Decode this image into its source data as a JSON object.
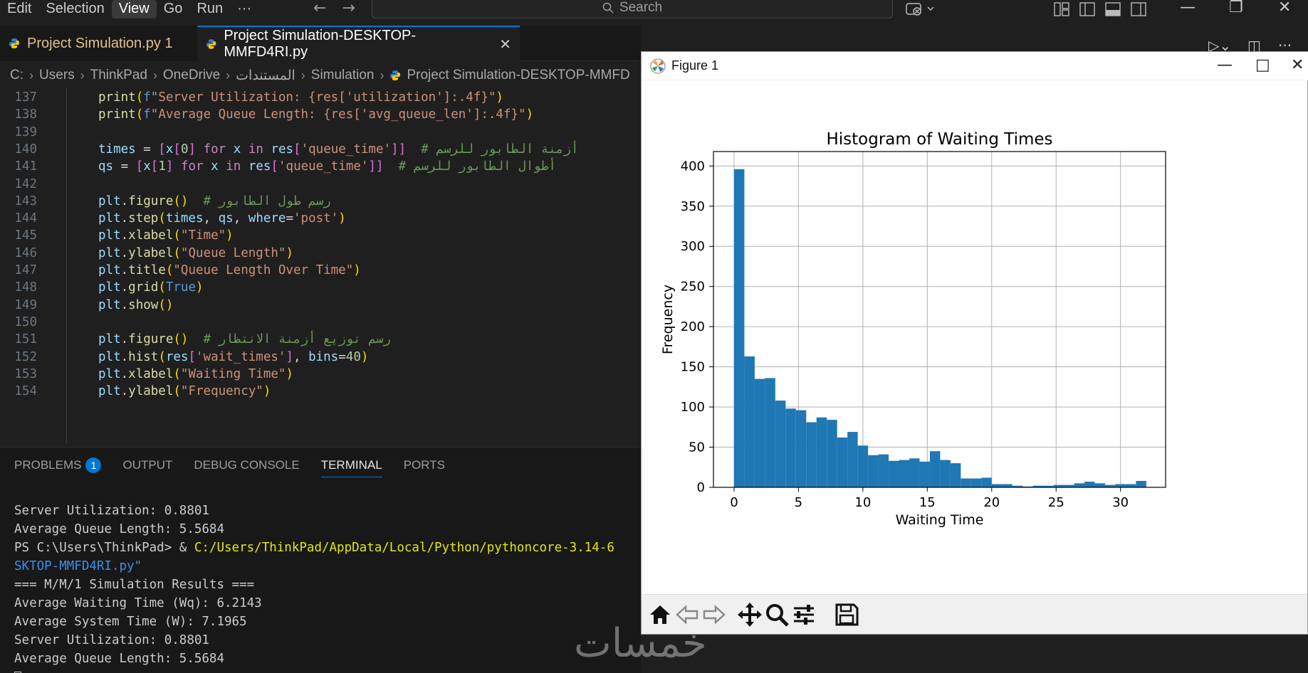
{
  "menu": {
    "items": [
      "Edit",
      "Selection",
      "View",
      "Go",
      "Run",
      "···"
    ],
    "active": "View"
  },
  "search": {
    "placeholder": "Search"
  },
  "tabs": [
    {
      "label": "Project Simulation.py 1",
      "modified": true
    },
    {
      "label": "Project Simulation-DESKTOP-MMFD4RI.py",
      "active": true
    }
  ],
  "breadcrumb": [
    "C:",
    "Users",
    "ThinkPad",
    "OneDrive",
    "المستندات",
    "Simulation",
    "Project Simulation-DESKTOP-MMFD"
  ],
  "editor": {
    "lines": [
      {
        "n": "137",
        "text": "print(f\"Server Utilization: {res['utilization']:.4f}\")"
      },
      {
        "n": "138",
        "text": "print(f\"Average Queue Length: {res['avg_queue_len']:.4f}\")"
      },
      {
        "n": "139",
        "text": ""
      },
      {
        "n": "140",
        "text": "times = [x[0] for x in res['queue_time']]  # أزمنة الطابور للرسم"
      },
      {
        "n": "141",
        "text": "qs = [x[1] for x in res['queue_time']]  # أطوال الطابور للرسم"
      },
      {
        "n": "142",
        "text": ""
      },
      {
        "n": "143",
        "text": "plt.figure()  # رسم طول الطابور"
      },
      {
        "n": "144",
        "text": "plt.step(times, qs, where='post')"
      },
      {
        "n": "145",
        "text": "plt.xlabel(\"Time\")"
      },
      {
        "n": "146",
        "text": "plt.ylabel(\"Queue Length\")"
      },
      {
        "n": "147",
        "text": "plt.title(\"Queue Length Over Time\")"
      },
      {
        "n": "148",
        "text": "plt.grid(True)"
      },
      {
        "n": "149",
        "text": "plt.show()"
      },
      {
        "n": "150",
        "text": ""
      },
      {
        "n": "151",
        "text": "plt.figure()  # رسم توزيع أزمنة الانتظار"
      },
      {
        "n": "152",
        "text": "plt.hist(res['wait_times'], bins=40)"
      },
      {
        "n": "153",
        "text": "plt.xlabel(\"Waiting Time\")"
      },
      {
        "n": "154",
        "text": "plt.ylabel(\"Frequency\")"
      }
    ]
  },
  "panel": {
    "tabs": [
      "PROBLEMS",
      "OUTPUT",
      "DEBUG CONSOLE",
      "TERMINAL",
      "PORTS"
    ],
    "active_tab": "TERMINAL",
    "problems_count": "1"
  },
  "terminal": {
    "line1": "Server Utilization: 0.8801",
    "line2": "Average Queue Length: 5.5684",
    "prompt": "PS C:\\Users\\ThinkPad> & ",
    "command": "C:/Users/ThinkPad/AppData/Local/Python/pythoncore-3.14-6",
    "continuation": "SKTOP-MMFD4RI.py\"",
    "line4": "=== M/M/1 Simulation Results ===",
    "line5": "Average Waiting Time (Wq): 6.2143",
    "line6": "Average System Time (W): 7.1965",
    "line7": "Server Utilization: 0.8801",
    "line8": "Average Queue Length: 5.5684"
  },
  "watermark": "خمسات",
  "figure": {
    "window_title": "Figure 1",
    "toolbar": [
      "home-icon",
      "back-icon",
      "forward-icon",
      "pan-icon",
      "zoom-icon",
      "configure-icon",
      "save-icon"
    ]
  },
  "chart_data": {
    "type": "bar",
    "title": "Histogram of Waiting Times",
    "xlabel": "Waiting Time",
    "ylabel": "Frequency",
    "xlim": [
      -1.6,
      33.5
    ],
    "ylim": [
      0,
      418
    ],
    "xticks": [
      0,
      5,
      10,
      15,
      20,
      25,
      30
    ],
    "yticks": [
      0,
      50,
      100,
      150,
      200,
      250,
      300,
      350,
      400
    ],
    "grid": true,
    "bar_color": "#1f77b4",
    "bin_start": 0.0,
    "bin_width": 0.8,
    "values": [
      396,
      163,
      135,
      136,
      108,
      98,
      96,
      81,
      87,
      84,
      62,
      69,
      52,
      40,
      41,
      33,
      34,
      36,
      32,
      45,
      34,
      30,
      11,
      11,
      12,
      4,
      4,
      2,
      1,
      2,
      2,
      3,
      3,
      5,
      7,
      5,
      3,
      4,
      4,
      8
    ]
  }
}
